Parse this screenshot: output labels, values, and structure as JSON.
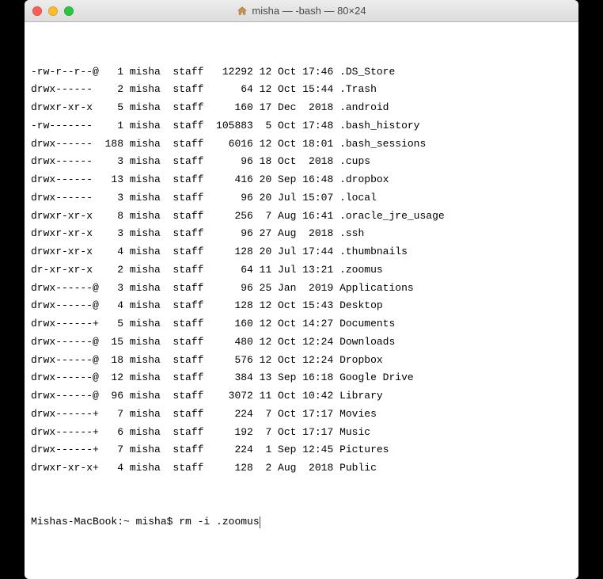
{
  "window": {
    "title": "misha — -bash — 80×24"
  },
  "listing": [
    {
      "perm": "-rw-r--r--@",
      "links": "1",
      "owner": "misha",
      "group": "staff",
      "size": "12292",
      "date": "12 Oct 17:46",
      "name": ".DS_Store"
    },
    {
      "perm": "drwx------ ",
      "links": "2",
      "owner": "misha",
      "group": "staff",
      "size": "64",
      "date": "12 Oct 15:44",
      "name": ".Trash"
    },
    {
      "perm": "drwxr-xr-x ",
      "links": "5",
      "owner": "misha",
      "group": "staff",
      "size": "160",
      "date": "17 Dec  2018",
      "name": ".android"
    },
    {
      "perm": "-rw------- ",
      "links": "1",
      "owner": "misha",
      "group": "staff",
      "size": "105883",
      "date": " 5 Oct 17:48",
      "name": ".bash_history"
    },
    {
      "perm": "drwx------ ",
      "links": "188",
      "owner": "misha",
      "group": "staff",
      "size": "6016",
      "date": "12 Oct 18:01",
      "name": ".bash_sessions"
    },
    {
      "perm": "drwx------ ",
      "links": "3",
      "owner": "misha",
      "group": "staff",
      "size": "96",
      "date": "18 Oct  2018",
      "name": ".cups"
    },
    {
      "perm": "drwx------ ",
      "links": "13",
      "owner": "misha",
      "group": "staff",
      "size": "416",
      "date": "20 Sep 16:48",
      "name": ".dropbox"
    },
    {
      "perm": "drwx------ ",
      "links": "3",
      "owner": "misha",
      "group": "staff",
      "size": "96",
      "date": "20 Jul 15:07",
      "name": ".local"
    },
    {
      "perm": "drwxr-xr-x ",
      "links": "8",
      "owner": "misha",
      "group": "staff",
      "size": "256",
      "date": " 7 Aug 16:41",
      "name": ".oracle_jre_usage"
    },
    {
      "perm": "drwxr-xr-x ",
      "links": "3",
      "owner": "misha",
      "group": "staff",
      "size": "96",
      "date": "27 Aug  2018",
      "name": ".ssh"
    },
    {
      "perm": "drwxr-xr-x ",
      "links": "4",
      "owner": "misha",
      "group": "staff",
      "size": "128",
      "date": "20 Jul 17:44",
      "name": ".thumbnails"
    },
    {
      "perm": "dr-xr-xr-x ",
      "links": "2",
      "owner": "misha",
      "group": "staff",
      "size": "64",
      "date": "11 Jul 13:21",
      "name": ".zoomus"
    },
    {
      "perm": "drwx------@",
      "links": "3",
      "owner": "misha",
      "group": "staff",
      "size": "96",
      "date": "25 Jan  2019",
      "name": "Applications"
    },
    {
      "perm": "drwx------@",
      "links": "4",
      "owner": "misha",
      "group": "staff",
      "size": "128",
      "date": "12 Oct 15:43",
      "name": "Desktop"
    },
    {
      "perm": "drwx------+",
      "links": "5",
      "owner": "misha",
      "group": "staff",
      "size": "160",
      "date": "12 Oct 14:27",
      "name": "Documents"
    },
    {
      "perm": "drwx------@",
      "links": "15",
      "owner": "misha",
      "group": "staff",
      "size": "480",
      "date": "12 Oct 12:24",
      "name": "Downloads"
    },
    {
      "perm": "drwx------@",
      "links": "18",
      "owner": "misha",
      "group": "staff",
      "size": "576",
      "date": "12 Oct 12:24",
      "name": "Dropbox"
    },
    {
      "perm": "drwx------@",
      "links": "12",
      "owner": "misha",
      "group": "staff",
      "size": "384",
      "date": "13 Sep 16:18",
      "name": "Google Drive"
    },
    {
      "perm": "drwx------@",
      "links": "96",
      "owner": "misha",
      "group": "staff",
      "size": "3072",
      "date": "11 Oct 10:42",
      "name": "Library"
    },
    {
      "perm": "drwx------+",
      "links": "7",
      "owner": "misha",
      "group": "staff",
      "size": "224",
      "date": " 7 Oct 17:17",
      "name": "Movies"
    },
    {
      "perm": "drwx------+",
      "links": "6",
      "owner": "misha",
      "group": "staff",
      "size": "192",
      "date": " 7 Oct 17:17",
      "name": "Music"
    },
    {
      "perm": "drwx------+",
      "links": "7",
      "owner": "misha",
      "group": "staff",
      "size": "224",
      "date": " 1 Sep 12:45",
      "name": "Pictures"
    },
    {
      "perm": "drwxr-xr-x+",
      "links": "4",
      "owner": "misha",
      "group": "staff",
      "size": "128",
      "date": " 2 Aug  2018",
      "name": "Public"
    }
  ],
  "prompt": {
    "host": "Mishas-MacBook",
    "path": "~",
    "user": "misha",
    "symbol": "$",
    "command": "rm -i .zoomus"
  }
}
